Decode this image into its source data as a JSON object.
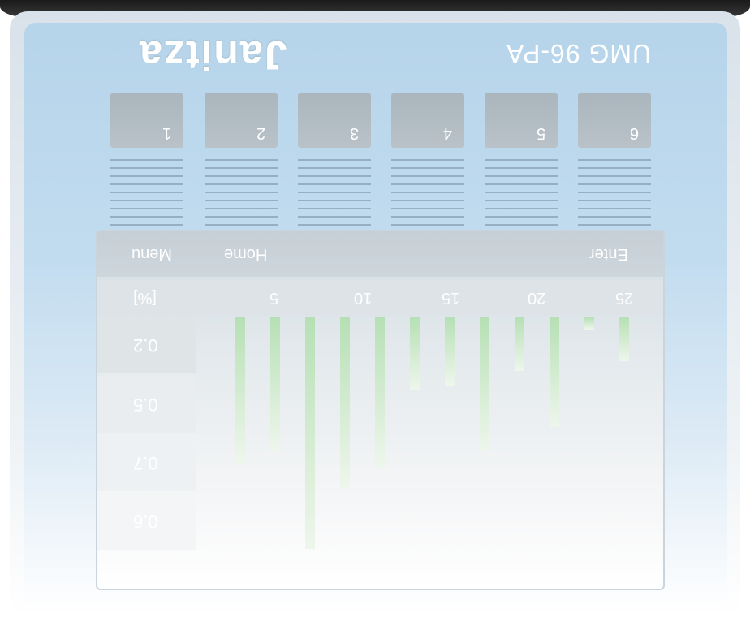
{
  "device": {
    "brand": "Janitza",
    "model": "UMG 96-PA"
  },
  "keys": [
    {
      "label": "1"
    },
    {
      "label": "2"
    },
    {
      "label": "3"
    },
    {
      "label": "4"
    },
    {
      "label": "5"
    },
    {
      "label": "6"
    }
  ],
  "display": {
    "menu_label": "Menu",
    "home_label": "Home",
    "enter_label": "Enter",
    "x_unit": "[%]",
    "x_ticks": [
      "5",
      "10",
      "15",
      "20",
      "25"
    ],
    "scale_values": [
      "0.2",
      "0.5",
      "0.7",
      "0.6"
    ],
    "harmonics": [
      {
        "h": 1,
        "level": 0.6
      },
      {
        "h": 2,
        "level": 0.55
      },
      {
        "h": 3,
        "level": 0.95
      },
      {
        "h": 4,
        "level": 0.7
      },
      {
        "h": 5,
        "level": 0.62
      },
      {
        "h": 6,
        "level": 0.3
      },
      {
        "h": 7,
        "level": 0.28
      },
      {
        "h": 8,
        "level": 0.55
      },
      {
        "h": 9,
        "level": 0.22
      },
      {
        "h": 10,
        "level": 0.45
      },
      {
        "h": 11,
        "level": 0.05
      },
      {
        "h": 12,
        "level": 0.18
      }
    ],
    "bar_color": "#b6e0b4"
  }
}
